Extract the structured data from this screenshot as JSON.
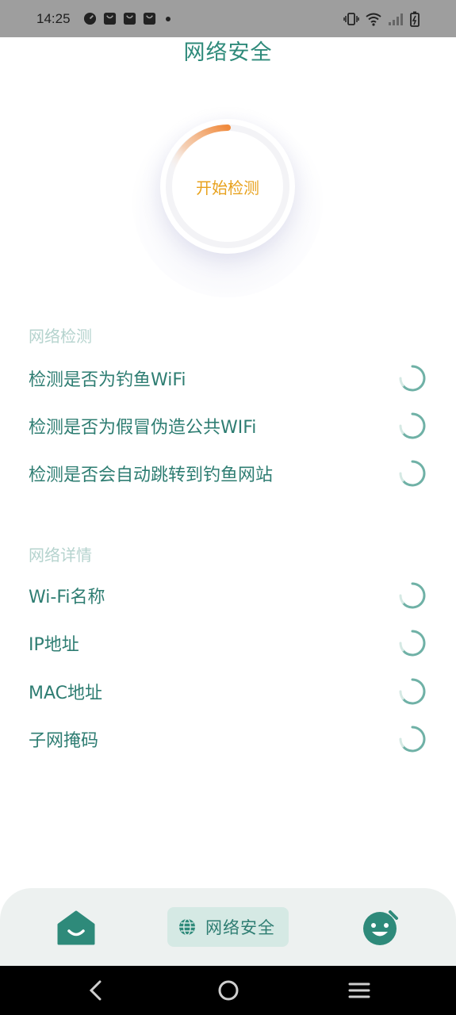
{
  "status_bar": {
    "time": "14:25",
    "left_icons": [
      "speedometer-icon",
      "bag-icon",
      "bag-icon",
      "bag-icon",
      "dot-icon"
    ],
    "right_icons": [
      "vibrate-icon",
      "wifi-icon",
      "signal-icon",
      "battery-icon"
    ]
  },
  "header": {
    "title": "网络安全"
  },
  "scan": {
    "button_label": "开始检测",
    "ring_color": "#f08a3c"
  },
  "network_check": {
    "section_title": "网络检测",
    "items": [
      {
        "label": "检测是否为钓鱼WiFi",
        "status": "loading"
      },
      {
        "label": "检测是否为假冒伪造公共WIFi",
        "status": "loading"
      },
      {
        "label": "检测是否会自动跳转到钓鱼网站",
        "status": "loading"
      }
    ]
  },
  "network_details": {
    "section_title": "网络详情",
    "items": [
      {
        "label": "Wi-Fi名称",
        "status": "loading"
      },
      {
        "label": "IP地址",
        "status": "loading"
      },
      {
        "label": "MAC地址",
        "status": "loading"
      },
      {
        "label": "子网掩码",
        "status": "loading"
      }
    ]
  },
  "bottom_nav": {
    "home_icon": "home-icon",
    "network_label": "网络安全",
    "network_icon": "globe-icon",
    "profile_icon": "smiley-face-icon",
    "accent": "#2e8a7a"
  },
  "system_nav": {
    "buttons": [
      "back-icon",
      "home-circle-icon",
      "menu-icon"
    ]
  }
}
